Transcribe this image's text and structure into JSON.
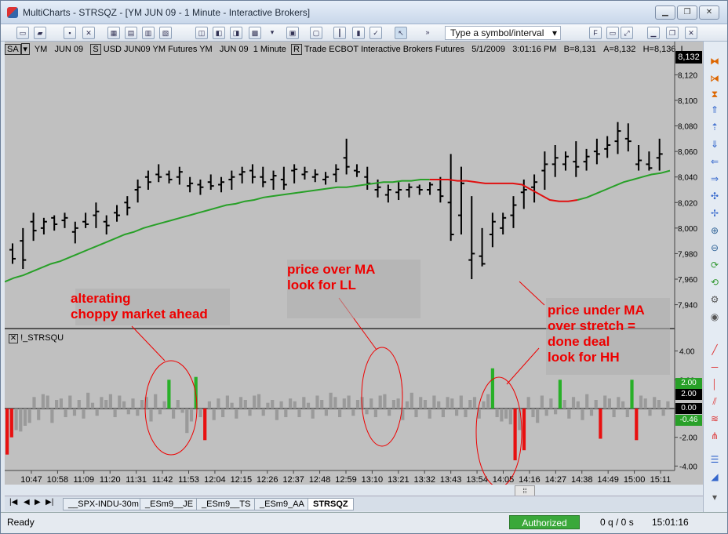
{
  "window": {
    "title": "MultiCharts - STRSQZ - [YM  JUN 09 - 1 Minute - Interactive Brokers]"
  },
  "toolbar": {
    "symbol_placeholder": "Type a symbol/interval"
  },
  "infobar": {
    "style_btn": "SA",
    "symbol": "YM",
    "contract": "JUN 09",
    "session_btn": "S",
    "description": "USD JUN09 YM Futures YM",
    "contract2": "JUN 09",
    "interval": "1 Minute",
    "mode_btn": "R",
    "data": "Trade  ECBOT  Interactive Brokers  Futures",
    "date": "5/1/2009",
    "time": "3:01:16 PM",
    "bid": "B=8,131",
    "ask": "A=8,132",
    "high": "H=8,136",
    "trunc": "L"
  },
  "price_axis": {
    "ticks": [
      "8,120",
      "8,100",
      "8,080",
      "8,060",
      "8,040",
      "8,020",
      "8,000",
      "7,980",
      "7,960",
      "7,940"
    ],
    "last_price": "8,132"
  },
  "indicator": {
    "name": "!_STRSQU"
  },
  "osc_axis": {
    "ticks": [
      "4.00",
      "2.00",
      "0.00",
      "-2.00",
      "-4.00"
    ],
    "markers": [
      "2.00",
      "0.00",
      "-0.46"
    ]
  },
  "time_axis": {
    "ticks": [
      "10:47",
      "10:58",
      "11:09",
      "11:20",
      "11:31",
      "11:42",
      "11:53",
      "12:04",
      "12:15",
      "12:26",
      "12:37",
      "12:48",
      "12:59",
      "13:10",
      "13:21",
      "13:32",
      "13:43",
      "13:54",
      "14:05",
      "14:16",
      "14:27",
      "14:38",
      "14:49",
      "15:00",
      "15:11"
    ]
  },
  "annotations": {
    "a1_line1": "alterating",
    "a1_line2": "choppy market ahead",
    "a2_line1": "price over MA",
    "a2_line2": "look for LL",
    "a3_line1": "price under MA",
    "a3_line2": "over stretch =",
    "a3_line3": "done deal",
    "a3_line4": "look for HH"
  },
  "tabs": [
    "__SPX-INDU-30m",
    "_ESm9__JE",
    "_ESm9__TS",
    "_ESm9_AA",
    "STRSQZ"
  ],
  "status": {
    "ready": "Ready",
    "authorized": "Authorized",
    "queue": "0 q / 0 s",
    "clock": "15:01:16"
  },
  "chart_data": {
    "type": "bar",
    "title": "YM JUN 09 - 1 Minute",
    "ylim": [
      7925,
      8135
    ],
    "price_bars": [
      [
        7988,
        7972,
        7983,
        7976
      ],
      [
        8000,
        7968,
        7990,
        7975
      ],
      [
        8012,
        7990,
        8005,
        7998
      ],
      [
        8008,
        7995,
        8000,
        8005
      ],
      [
        8010,
        7998,
        8008,
        8003
      ],
      [
        8012,
        8000,
        8006,
        8008
      ],
      [
        8005,
        7988,
        7997,
        8000
      ],
      [
        8012,
        8000,
        8005,
        8003
      ],
      [
        8020,
        8000,
        8010,
        8013
      ],
      [
        8010,
        7995,
        8005,
        8002
      ],
      [
        8018,
        8005,
        8012,
        8010
      ],
      [
        8025,
        8010,
        8020,
        8016
      ],
      [
        8038,
        8020,
        8030,
        8032
      ],
      [
        8045,
        8030,
        8040,
        8036
      ],
      [
        8050,
        8036,
        8042,
        8040
      ],
      [
        8045,
        8035,
        8042,
        8038
      ],
      [
        8048,
        8034,
        8040,
        8044
      ],
      [
        8040,
        8028,
        8033,
        8035
      ],
      [
        8038,
        8026,
        8034,
        8032
      ],
      [
        8042,
        8030,
        8036,
        8033
      ],
      [
        8040,
        8028,
        8034,
        8036
      ],
      [
        8045,
        8030,
        8038,
        8040
      ],
      [
        8048,
        8035,
        8042,
        8044
      ],
      [
        8050,
        8035,
        8045,
        8040
      ],
      [
        8048,
        8032,
        8040,
        8036
      ],
      [
        8045,
        8030,
        8038,
        8041
      ],
      [
        8048,
        8030,
        8038,
        8034
      ],
      [
        8050,
        8035,
        8045,
        8046
      ],
      [
        8048,
        8038,
        8042,
        8044
      ],
      [
        8046,
        8036,
        8040,
        8042
      ],
      [
        8044,
        8034,
        8038,
        8040
      ],
      [
        8050,
        8036,
        8042,
        8046
      ],
      [
        8070,
        8042,
        8055,
        8048
      ],
      [
        8050,
        8040,
        8045,
        8044
      ],
      [
        8048,
        8030,
        8040,
        8035
      ],
      [
        8038,
        8024,
        8030,
        8032
      ],
      [
        8034,
        8020,
        8026,
        8030
      ],
      [
        8036,
        8022,
        8028,
        8030
      ],
      [
        8035,
        8024,
        8030,
        8032
      ],
      [
        8034,
        8026,
        8032,
        8030
      ],
      [
        8036,
        8026,
        8030,
        8034
      ],
      [
        8040,
        8020,
        8030,
        8025
      ],
      [
        8058,
        7990,
        8020,
        7995
      ],
      [
        8048,
        7995,
        8010,
        8035
      ],
      [
        8025,
        7960,
        7975,
        7980
      ],
      [
        8000,
        7970,
        7978,
        7972
      ],
      [
        8012,
        7985,
        7995,
        8005
      ],
      [
        8012,
        7995,
        8000,
        8008
      ],
      [
        8025,
        8000,
        8010,
        8018
      ],
      [
        8038,
        8015,
        8028,
        8030
      ],
      [
        8042,
        8020,
        8032,
        8036
      ],
      [
        8060,
        8030,
        8045,
        8050
      ],
      [
        8065,
        8040,
        8050,
        8055
      ],
      [
        8060,
        8045,
        8050,
        8056
      ],
      [
        8068,
        8040,
        8052,
        8048
      ],
      [
        8062,
        8045,
        8052,
        8056
      ],
      [
        8070,
        8050,
        8060,
        8058
      ],
      [
        8072,
        8055,
        8062,
        8065
      ],
      [
        8083,
        8058,
        8068,
        8076
      ],
      [
        8082,
        8060,
        8070,
        8068
      ],
      [
        8065,
        8045,
        8050,
        8053
      ],
      [
        8060,
        8045,
        8050,
        8047
      ],
      [
        8070,
        8045,
        8055,
        8058
      ]
    ],
    "moving_average": [
      7958,
      7961,
      7963,
      7966,
      7969,
      7972,
      7974,
      7977,
      7980,
      7983,
      7986,
      7989,
      7992,
      7995,
      7997,
      8000,
      8002,
      8004,
      8006,
      8008,
      8010,
      8012,
      8014,
      8016,
      8018,
      8019,
      8021,
      8022,
      8024,
      8025,
      8026,
      8027,
      8028,
      8029,
      8030,
      8031,
      8032,
      8032,
      8033,
      8034,
      8035,
      8036,
      8036,
      8037,
      8037,
      8038,
      8038,
      8038,
      8038,
      8037,
      8037,
      8036,
      8035,
      8035,
      8035,
      8035,
      8034,
      8030,
      8026,
      8022,
      8021,
      8021,
      8022,
      8024,
      8027,
      8030,
      8033,
      8036,
      8038,
      8040,
      8042,
      8043,
      8045
    ],
    "ma_red_range": [
      46,
      62
    ],
    "oscillator_ylim": [
      -4.8,
      4.8
    ],
    "oscillator": [
      -3.2,
      -2.0,
      -1.5,
      -1.6,
      -1.2,
      -1.0,
      0.8,
      -0.8,
      1.0,
      0.9,
      -1.0,
      0.6,
      0.7,
      -0.6,
      0.9,
      -0.5,
      0.6,
      -0.7,
      1.1,
      0.4,
      -0.5,
      0.8,
      0.6,
      1.0,
      -0.6,
      0.9,
      0.5,
      -0.4,
      0.7,
      -0.5,
      0.6,
      0.8,
      -0.9,
      1.0,
      -0.4,
      0.5,
      2.0,
      -0.7,
      0.6,
      -0.3,
      -1.7,
      -0.9,
      2.2,
      -0.6,
      -2.2,
      0.5,
      -0.8,
      0.7,
      -0.6,
      0.9,
      0.4,
      -0.7,
      0.8,
      0.6,
      -0.5,
      0.9,
      1.0,
      -0.5,
      0.4,
      0.6,
      -0.8,
      0.5,
      -0.6,
      0.7,
      0.5,
      -0.6,
      0.8,
      0.4,
      -0.7,
      0.9,
      0.6,
      -0.5,
      1.1,
      0.8,
      -0.6,
      0.7,
      0.9,
      -0.5,
      0.6,
      0.8,
      -0.4,
      0.7,
      -0.6,
      0.9,
      1.0,
      -0.5,
      0.6,
      0.7,
      -0.8,
      0.5,
      1.1,
      -0.6,
      0.8,
      0.6,
      -0.7,
      0.9,
      0.5,
      -0.6,
      0.8,
      0.7,
      -0.5,
      0.9,
      -0.6,
      0.6,
      0.8,
      -0.7,
      0.5,
      1.0,
      2.8,
      -0.6,
      -0.9,
      -0.7,
      -1.1,
      -3.6,
      -1.5,
      -2.9,
      0.8,
      -0.6,
      -1.0,
      0.9,
      -0.5,
      0.7,
      -0.4,
      2.0,
      0.6,
      -0.7,
      0.8,
      0.5,
      -0.8,
      1.0,
      -0.5,
      0.6,
      -2.1,
      0.9,
      0.7,
      -0.6,
      0.8,
      0.5,
      -0.6,
      2.0,
      -2.2,
      0.9,
      0.7,
      -0.5,
      0.8,
      0.6,
      -0.5,
      0.5
    ],
    "oscillator_color_threshold": 1.9
  },
  "colors": {
    "ma_green": "#28a028",
    "ma_red": "#e01010",
    "osc_green": "#28b028",
    "osc_red": "#e81010",
    "osc_gray": "#9a9a9a"
  }
}
